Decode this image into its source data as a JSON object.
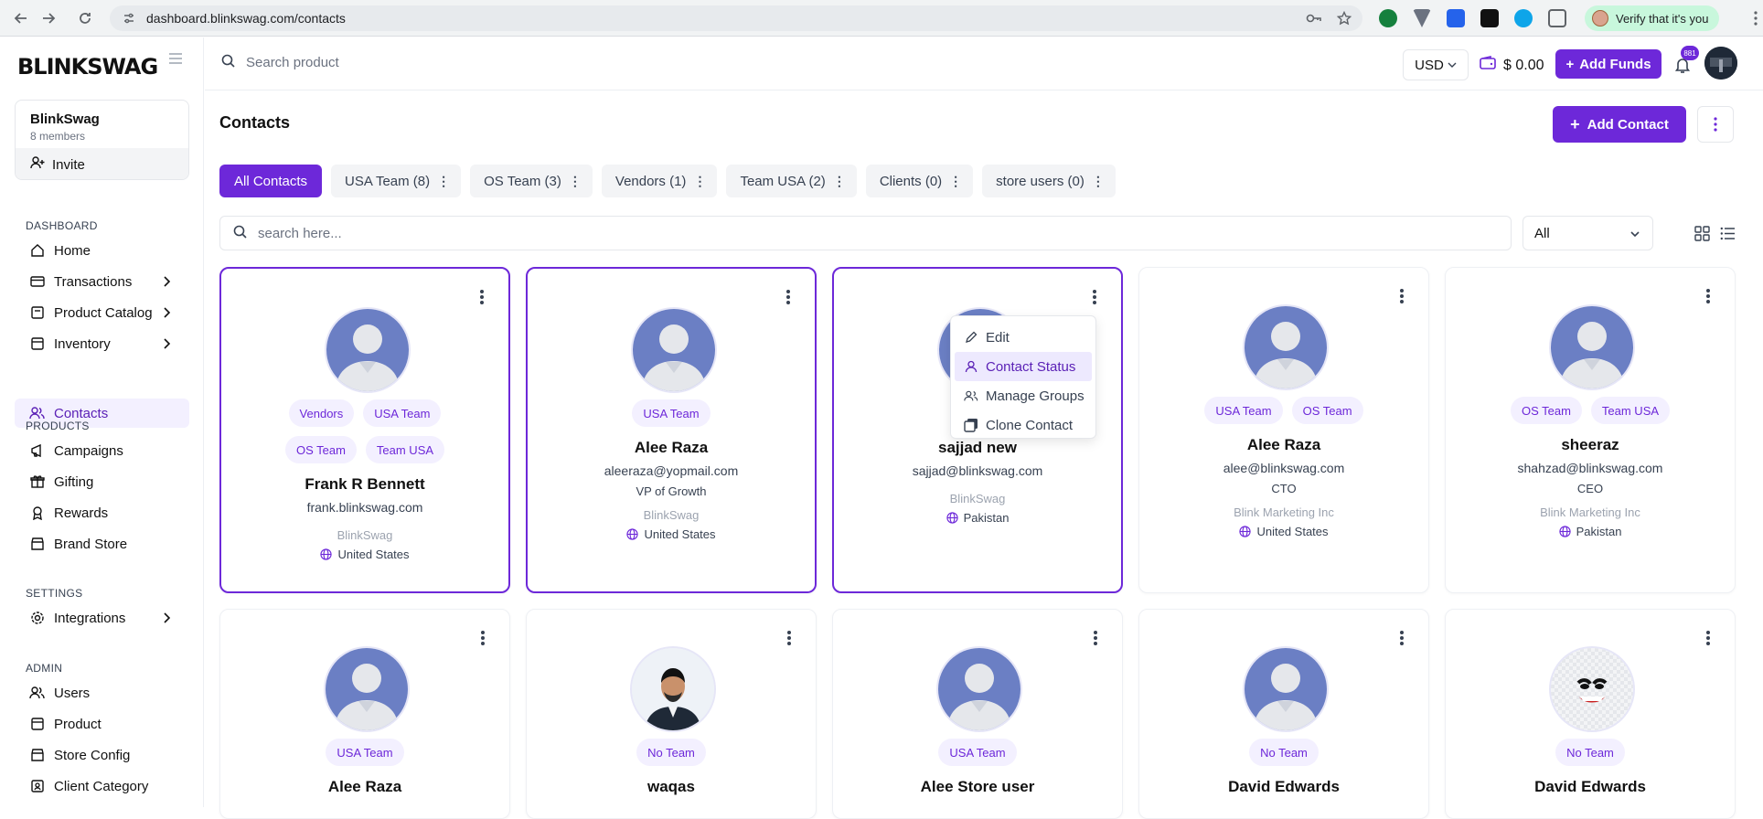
{
  "browser": {
    "url": "dashboard.blinkswag.com/contacts",
    "verify_label": "Verify that it's you"
  },
  "sidebar": {
    "logo": "BLINKSWAG",
    "org_name": "BlinkSwag",
    "org_members": "8 members",
    "invite_label": "Invite",
    "sections": {
      "dashboard": "DASHBOARD",
      "products": "PRODUCTS",
      "settings": "SETTINGS",
      "admin": "ADMIN"
    },
    "items": {
      "home": "Home",
      "transactions": "Transactions",
      "product_catalog": "Product Catalog",
      "inventory": "Inventory",
      "contacts": "Contacts",
      "campaigns": "Campaigns",
      "gifting": "Gifting",
      "rewards": "Rewards",
      "brand_store": "Brand Store",
      "integrations": "Integrations",
      "users": "Users",
      "product": "Product",
      "store_config": "Store Config",
      "client_category": "Client Category"
    }
  },
  "topbar": {
    "search_placeholder": "Search product",
    "currency": "USD",
    "balance": "$ 0.00",
    "add_funds": "Add Funds",
    "notification_count": "881"
  },
  "main": {
    "title": "Contacts",
    "add_contact": "Add Contact",
    "tabs": [
      "All Contacts",
      "USA Team (8)",
      "OS Team (3)",
      "Vendors (1)",
      "Team USA (2)",
      "Clients (0)",
      "store users (0)"
    ],
    "search_placeholder": "search here...",
    "filter_value": "All"
  },
  "cards": [
    {
      "tags": [
        "Vendors",
        "USA Team",
        "OS Team",
        "Team USA"
      ],
      "name": "Frank R Bennett",
      "email": "frank.blinkswag.com",
      "title": "",
      "company": "BlinkSwag",
      "country": "United States"
    },
    {
      "tags": [
        "USA Team"
      ],
      "name": "Alee Raza",
      "email": "aleeraza@yopmail.com",
      "title": "VP of Growth",
      "company": "BlinkSwag",
      "country": "United States"
    },
    {
      "tags": [],
      "name": "sajjad new",
      "email": "sajjad@blinkswag.com",
      "title": "",
      "company": "BlinkSwag",
      "country": "Pakistan"
    },
    {
      "tags": [
        "USA Team",
        "OS Team"
      ],
      "name": "Alee Raza",
      "email": "alee@blinkswag.com",
      "title": "CTO",
      "company": "Blink Marketing Inc",
      "country": "United States"
    },
    {
      "tags": [
        "OS Team",
        "Team USA"
      ],
      "name": "sheeraz",
      "email": "shahzad@blinkswag.com",
      "title": "CEO",
      "company": "Blink Marketing Inc",
      "country": "Pakistan"
    },
    {
      "tags": [
        "USA Team"
      ],
      "name": "Alee Raza",
      "email": "",
      "title": "",
      "company": "",
      "country": ""
    },
    {
      "tags": [
        "No Team"
      ],
      "name": "waqas",
      "email": "",
      "title": "",
      "company": "",
      "country": ""
    },
    {
      "tags": [
        "USA Team"
      ],
      "name": "Alee Store user",
      "email": "",
      "title": "",
      "company": "",
      "country": ""
    },
    {
      "tags": [
        "No Team"
      ],
      "name": "David Edwards",
      "email": "",
      "title": "",
      "company": "",
      "country": ""
    },
    {
      "tags": [
        "No Team"
      ],
      "name": "David Edwards",
      "email": "",
      "title": "",
      "company": "",
      "country": ""
    }
  ],
  "context_menu": {
    "edit": "Edit",
    "contact_status": "Contact Status",
    "manage_groups": "Manage Groups",
    "clone_contact": "Clone Contact"
  },
  "colors": {
    "accent": "#6d28d9",
    "tag_bg": "#f3f0ff",
    "avatar_bg": "#6b7fc4"
  }
}
